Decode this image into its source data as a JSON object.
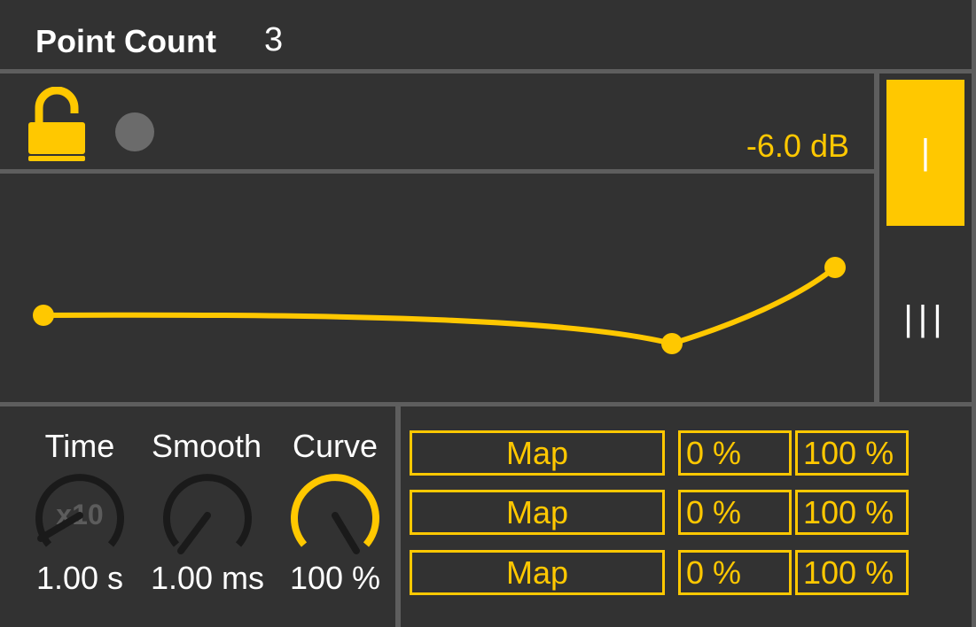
{
  "header": {
    "point_count_label": "Point Count",
    "point_count_value": "3"
  },
  "status": {
    "lock_state": "unlocked",
    "gain_readout": "-6.0 dB"
  },
  "mode_buttons": [
    {
      "label": "|",
      "active": true
    },
    {
      "label": "|||",
      "active": false
    }
  ],
  "knobs": [
    {
      "label": "Time",
      "value": "1.00 s",
      "overlay": "x10",
      "level": 0.0,
      "active": false
    },
    {
      "label": "Smooth",
      "value": "1.00 ms",
      "level": 0.0,
      "active": false
    },
    {
      "label": "Curve",
      "value": "100 %",
      "level": 1.0,
      "active": true
    }
  ],
  "mappings": [
    {
      "map_label": "Map",
      "min": "0 %",
      "max": "100 %"
    },
    {
      "map_label": "Map",
      "min": "0 %",
      "max": "100 %"
    },
    {
      "map_label": "Map",
      "min": "0 %",
      "max": "100 %"
    }
  ],
  "colors": {
    "accent": "#ffc800",
    "background": "#323232",
    "divider": "#5e5e5e",
    "inactive_knob": "#1a1a1a",
    "dot": "#6b6b6b"
  },
  "icons": {
    "lock": "padlock-open-icon",
    "indicator": "status-dot-icon"
  }
}
